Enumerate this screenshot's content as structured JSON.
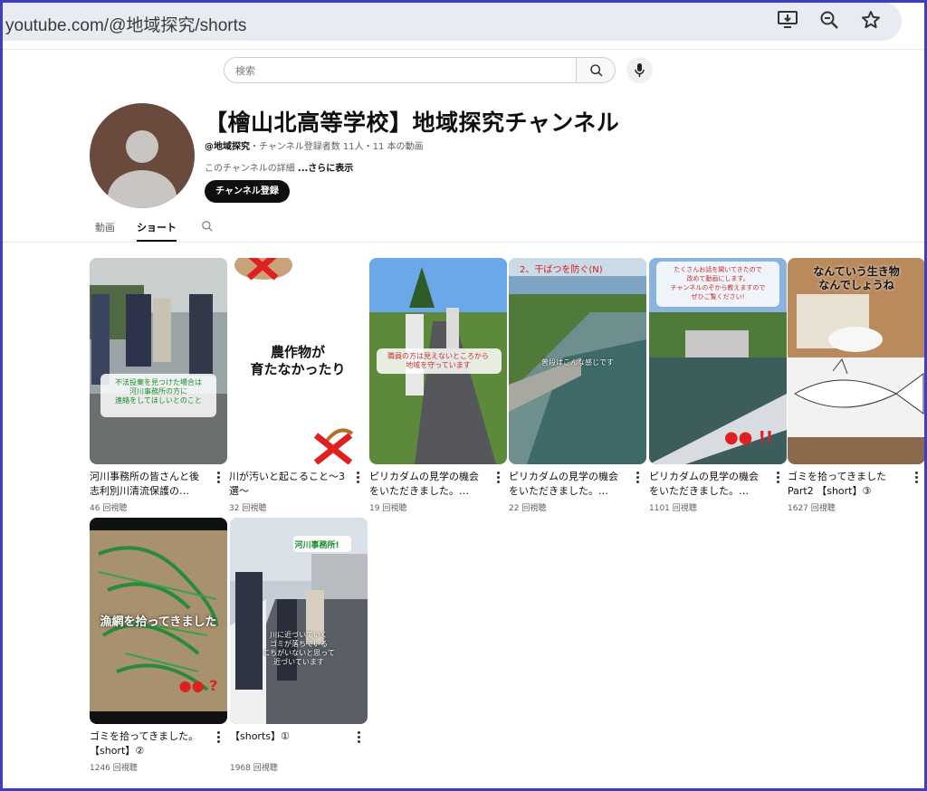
{
  "browser": {
    "url": "youtube.com/@地域探究/shorts",
    "icons": [
      "install-app-icon",
      "zoom-icon",
      "bookmark-star-icon"
    ]
  },
  "masthead": {
    "search_placeholder": "検索",
    "icons": [
      "search-icon",
      "mic-icon"
    ]
  },
  "channel": {
    "title": "【檜山北高等学校】地域探究チャンネル",
    "handle": "@地域探究",
    "stats": "・チャンネル登録者数 11人・11 本の動画",
    "description": "このチャンネルの詳細 ",
    "more_label": "...さらに表示",
    "subscribe_label": "チャンネル登録"
  },
  "tabs": [
    {
      "label": "動画",
      "active": false
    },
    {
      "label": "ショート",
      "active": true
    }
  ],
  "shorts": [
    {
      "title": "河川事務所の皆さんと後志利別川清流保護の…",
      "views": "46 回視聴",
      "overlay": [
        "不法投棄を見つけた場合は",
        "河川事務所の方に",
        "連絡をしてほしいとのこと"
      ]
    },
    {
      "title": "川が汚いと起こること〜3選〜",
      "views": "32 回視聴",
      "overlay": [
        "農作物が",
        "育たなかったり"
      ]
    },
    {
      "title": "ピリカダムの見学の機会をいただきました。…",
      "views": "19 回視聴",
      "overlay": [
        "職員の方は見えないところから",
        "地域を守っています"
      ]
    },
    {
      "title": "ピリカダムの見学の機会をいただきました。…",
      "views": "22 回視聴",
      "overlay": [
        "2、干ばつを防ぐ(N)",
        "普段はこんな感じです"
      ]
    },
    {
      "title": "ピリカダムの見学の機会をいただきました。…",
      "views": "1101 回視聴",
      "overlay": [
        "たくさんお話を聞いてきたので",
        "改めて動画にします。",
        "チャンネルのぞから教えますので",
        "ぜひご覧ください!"
      ]
    },
    {
      "title": "ゴミを拾ってきました Part2 【short】③",
      "views": "1627 回視聴",
      "overlay": [
        "なんていう生き物",
        "なんでしょうね"
      ]
    },
    {
      "title": "ゴミを拾ってきました。【short】②",
      "views": "1246 回視聴",
      "overlay": [
        "漁網を拾ってきました"
      ]
    },
    {
      "title": "【shorts】①",
      "views": "1968 回視聴",
      "overlay": [
        "河川事務所!",
        "川に近づいていく",
        "ゴミが落ちている",
        "にちがいないと思って",
        "近づいています"
      ]
    }
  ],
  "colors": {
    "avatar_bg": "#6b4a3e",
    "frame": "#3d3dc8",
    "address_bar": "#e9ebf3"
  }
}
